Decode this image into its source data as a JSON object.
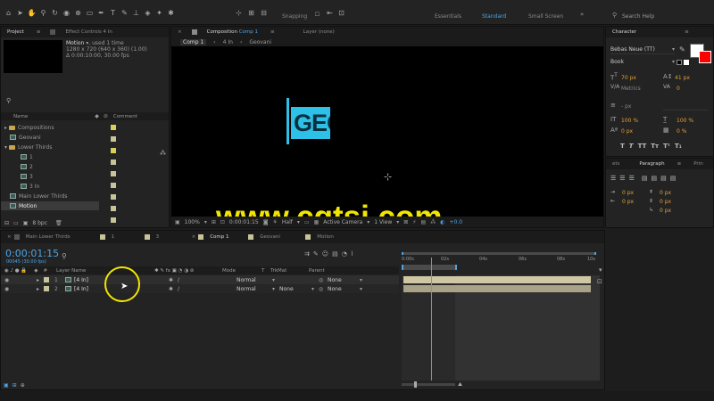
{
  "toolbar": {
    "snapping": "Snapping",
    "workspaces": [
      "Essentials",
      "Standard",
      "Small Screen"
    ],
    "active_workspace": "Standard",
    "search_placeholder": "Search Help"
  },
  "project": {
    "tab_project": "Project",
    "tab_effect_controls": "Effect Controls 4 In",
    "selected_name": "Motion",
    "selected_used": ", used 1 time",
    "selected_info1": "1280 x 720 (640 x 360) (1.00)",
    "selected_info2": "Δ 0:00:10:00, 30.00 fps",
    "col_name": "Name",
    "col_comment": "Comment",
    "items": [
      {
        "label": "Compositions",
        "type": "folder"
      },
      {
        "label": "Geovani",
        "type": "comp"
      },
      {
        "label": "Lower Thirds",
        "type": "folder"
      },
      {
        "label": "1",
        "type": "comp"
      },
      {
        "label": "2",
        "type": "comp"
      },
      {
        "label": "3",
        "type": "comp"
      },
      {
        "label": "3 In",
        "type": "comp"
      },
      {
        "label": "Main Lower Thirds",
        "type": "comp"
      },
      {
        "label": "Motion",
        "type": "comp"
      }
    ],
    "bpc": "8 bpc"
  },
  "composition": {
    "tab_label": "Composition",
    "tab_comp": "Comp 1",
    "layer_tab": "Layer (none)",
    "breadcrumbs": [
      "Comp 1",
      "4 In",
      "Geovani"
    ],
    "lower_third_text": "GEO",
    "watermark": "www.cgtsj.com",
    "zoom": "100%",
    "timecode": "0:00:01:15",
    "resolution": "Half",
    "camera": "Active Camera",
    "view": "1 View",
    "exposure": "+0.0"
  },
  "character": {
    "tab": "Character",
    "font": "Bebas Neue (TT)",
    "style": "Book",
    "size": "70 px",
    "leading": "41 px",
    "kerning": "Metrics",
    "tracking": "0",
    "stroke": "- px",
    "vscale": "100 %",
    "hscale": "100 %",
    "baseline": "0 px",
    "tsume": "0 %",
    "style_buttons": [
      "T",
      "T",
      "TT",
      "Tт",
      "T¹",
      "T₁"
    ]
  },
  "paragraph": {
    "tabs": [
      "ets",
      "Paragraph",
      "Prin"
    ],
    "active_tab": "Paragraph",
    "indent_values": [
      "0 px",
      "0 px",
      "0 px",
      "0 px",
      "0 px"
    ]
  },
  "timeline": {
    "tabs": [
      "Main Lower Thirds",
      "1",
      "3",
      "Comp 1",
      "Geovani",
      "Motion"
    ],
    "active_tab": "Comp 1",
    "timecode": "0:00:01:15",
    "frames": "00045 (30.00 fps)",
    "columns": {
      "layer_name": "Layer Name",
      "mode": "Mode",
      "t": "T",
      "trkmat": "TrkMat",
      "parent": "Parent"
    },
    "ruler": [
      "0:00s",
      "02s",
      "04s",
      "06s",
      "08s",
      "10s"
    ],
    "playhead_fraction": 0.15,
    "layers": [
      {
        "num": "1",
        "name": "[4 In]",
        "mode": "Normal",
        "trkmat": "",
        "parent": "None"
      },
      {
        "num": "2",
        "name": "[4 In]",
        "mode": "Normal",
        "trkmat": "None",
        "parent": "None"
      }
    ]
  },
  "colors": {
    "accent": "#4fa3e0",
    "watermark": "#f2e600",
    "lower_third": "#2ec1e8",
    "cursor_ring": "#f2e600"
  }
}
